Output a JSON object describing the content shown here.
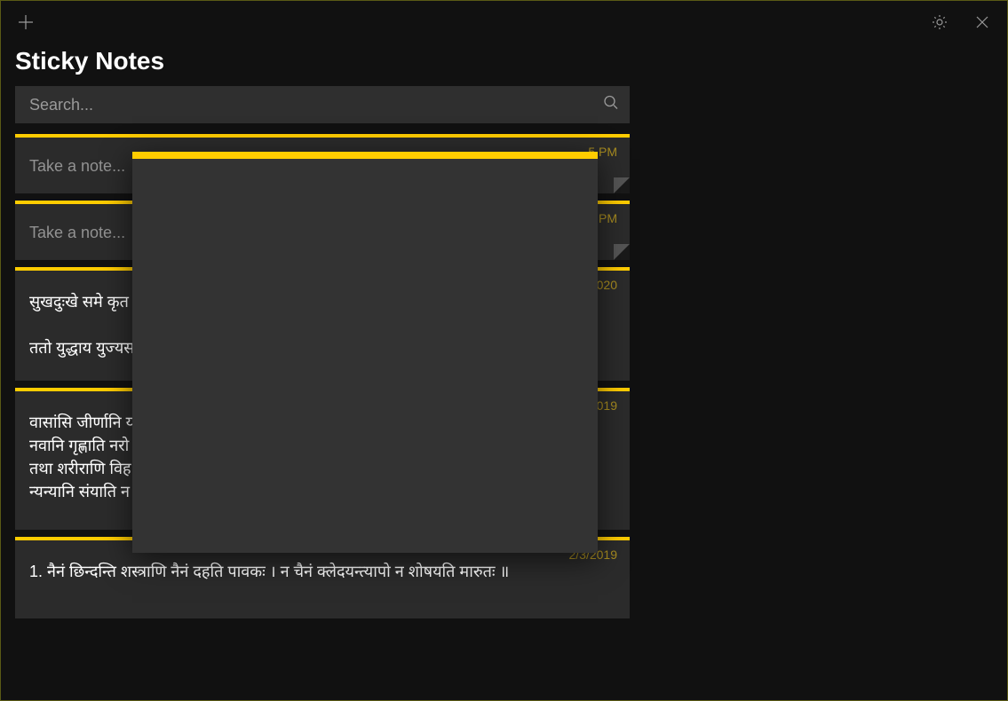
{
  "header": {
    "title": "Sticky Notes"
  },
  "search": {
    "placeholder": "Search..."
  },
  "icons": {
    "add": "plus-icon",
    "settings": "gear-icon",
    "close": "close-icon",
    "search": "search-icon"
  },
  "notes": [
    {
      "time": "5 PM",
      "placeholder": "Take a note...",
      "text": "",
      "has_fold": true
    },
    {
      "time": "4 PM",
      "placeholder": "Take a note...",
      "text": "",
      "has_fold": true
    },
    {
      "time": "2020",
      "placeholder": "",
      "text": "सुखदुःखे समे कृत\n\nततो युद्धाय युज्यस",
      "has_fold": false
    },
    {
      "time": "2019",
      "placeholder": "",
      "text": "वासांसि जीर्णानि य\nनवानि गृह्णाति नरो\nतथा शरीराणि विह\nन्यन्यानि संयाति न",
      "has_fold": false
    },
    {
      "time": "2/3/2019",
      "placeholder": "",
      "text": "1. नैनं छिन्दन्ति शस्त्राणि नैनं दहति पावकः । न चैनं क्लेदयन्त्यापो न शोषयति मारुतः ॥",
      "has_fold": false
    }
  ],
  "colors": {
    "accent": "#ffcc00",
    "background": "#111111",
    "card": "#2b2b2b",
    "floating": "#333333"
  }
}
